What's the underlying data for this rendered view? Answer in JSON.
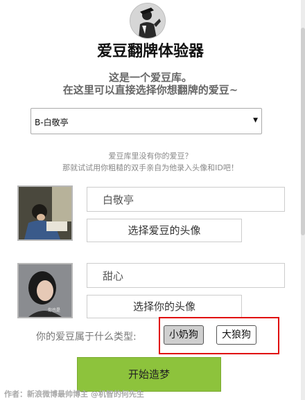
{
  "header": {
    "logo_icon": "avatar-silhouette-icon",
    "title": "爱豆翻牌体验器",
    "intro_line1": "这是一个爱豆库。",
    "intro_line2": "在这里可以直接选择你想翻牌的爱豆~"
  },
  "idol_select": {
    "selected": "B-白敬亭",
    "arrow_icon": "triangle-down-icon"
  },
  "hint": {
    "line1": "爱豆库里没有你的爱豆？",
    "line2": "那就试试用你粗糙的双手亲自为他录入头像和ID吧！"
  },
  "idol": {
    "name_value": "白敬亭",
    "choose_avatar_label": "选择爱豆的头像"
  },
  "user": {
    "name_value": "甜心",
    "photo_caption": "你也是",
    "choose_avatar_label": "选择你的头像"
  },
  "type_question": {
    "label": "你的爱豆属于什么类型:",
    "options": [
      "小奶狗",
      "大狼狗"
    ],
    "selected_index": 0,
    "highlight_color": "#e00000"
  },
  "start_button": {
    "label": "开始造梦",
    "color": "#8dc33c"
  },
  "credit": "作者：新浪微博最帅博主 @机智的何先生"
}
